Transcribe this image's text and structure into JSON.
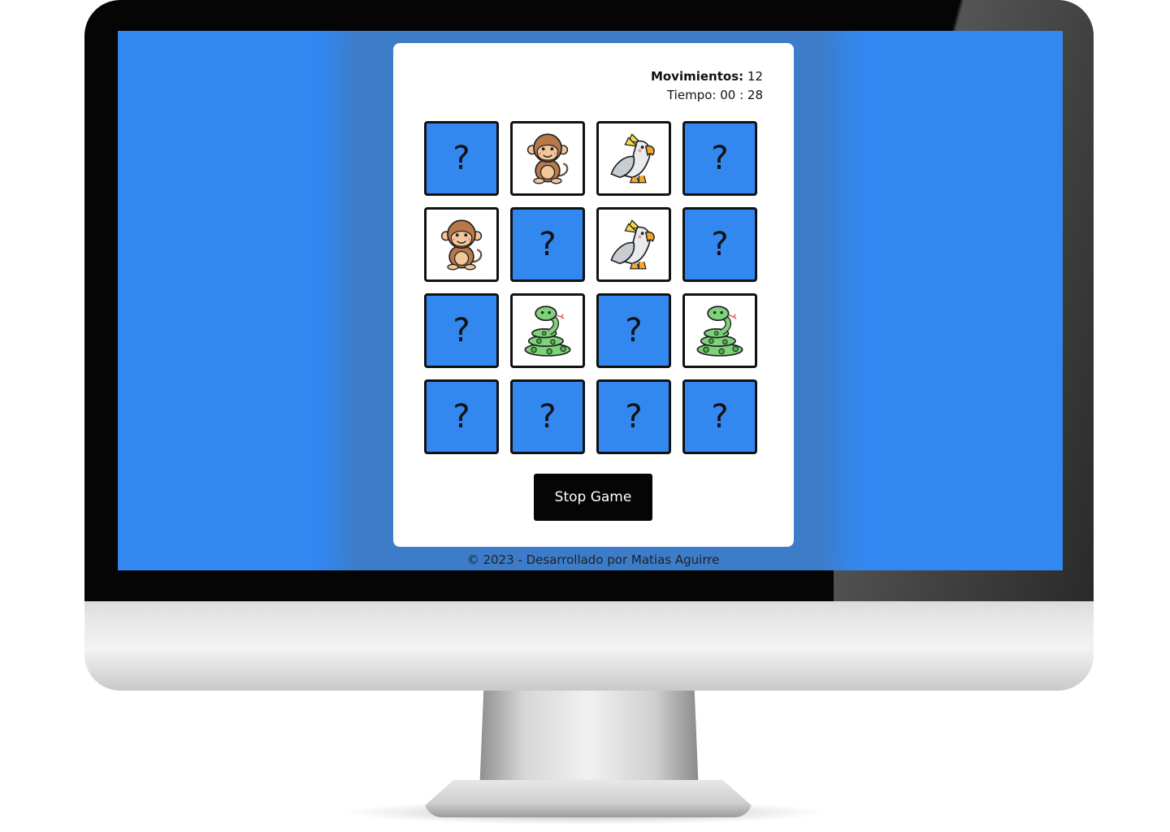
{
  "game": {
    "moves_label": "Movimientos:",
    "moves_value": "12",
    "time_label": "Tiempo:",
    "time_value": "00 : 28",
    "hidden_symbol": "?",
    "stop_button": "Stop Game",
    "colors": {
      "screen_background": "#3388f0",
      "card_background": "#ffffff",
      "hidden_tile": "#3388f0",
      "tile_border": "#111111",
      "button": "#050505"
    },
    "tiles": [
      {
        "state": "hidden",
        "animal": null
      },
      {
        "state": "shown",
        "animal": "monkey-icon"
      },
      {
        "state": "shown",
        "animal": "parrot-icon"
      },
      {
        "state": "hidden",
        "animal": null
      },
      {
        "state": "shown",
        "animal": "monkey-icon"
      },
      {
        "state": "hidden",
        "animal": null
      },
      {
        "state": "shown",
        "animal": "parrot-icon"
      },
      {
        "state": "hidden",
        "animal": null
      },
      {
        "state": "hidden",
        "animal": null
      },
      {
        "state": "shown",
        "animal": "snake-icon"
      },
      {
        "state": "hidden",
        "animal": null
      },
      {
        "state": "shown",
        "animal": "snake-icon"
      },
      {
        "state": "hidden",
        "animal": null
      },
      {
        "state": "hidden",
        "animal": null
      },
      {
        "state": "hidden",
        "animal": null
      },
      {
        "state": "hidden",
        "animal": null
      }
    ]
  },
  "footer": {
    "text": "© 2023 - Desarrollado por Matias Aguirre"
  }
}
